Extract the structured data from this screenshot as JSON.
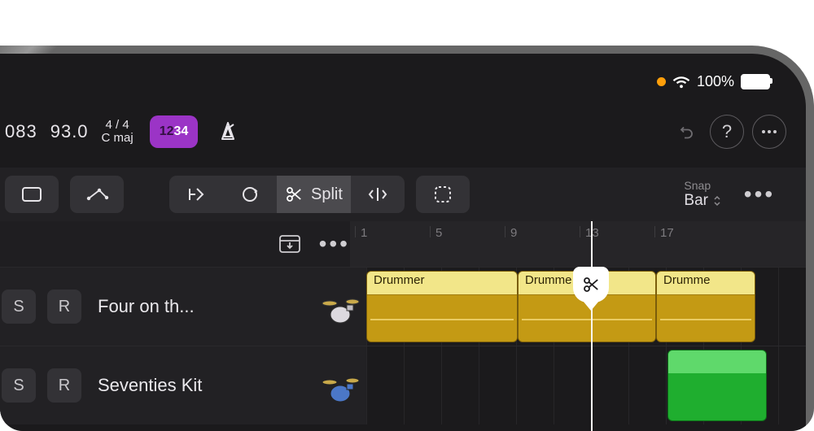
{
  "status": {
    "battery": "100%"
  },
  "transport": {
    "position": "083",
    "tempo": "93.0",
    "time_signature": "4 / 4",
    "key": "C maj",
    "count_dim": "12",
    "count_active": "34"
  },
  "toolbar": {
    "split_label": "Split",
    "snap_label": "Snap",
    "snap_value": "Bar"
  },
  "ruler": [
    "1",
    "5",
    "9",
    "13",
    "17"
  ],
  "tracks": [
    {
      "solo": "S",
      "rec": "R",
      "name": "Four on th...",
      "regions": [
        {
          "name": "Drummer"
        },
        {
          "name": "Drumme"
        },
        {
          "name": "Drumme"
        }
      ]
    },
    {
      "solo": "S",
      "rec": "R",
      "name": "Seventies Kit",
      "regions": [
        {
          "name": ""
        }
      ]
    }
  ],
  "colors": {
    "accent_purple": "#9b34c6",
    "region_yellow": "#c49a14",
    "region_green": "#1fae2f",
    "bg": "#1b1a1c"
  }
}
